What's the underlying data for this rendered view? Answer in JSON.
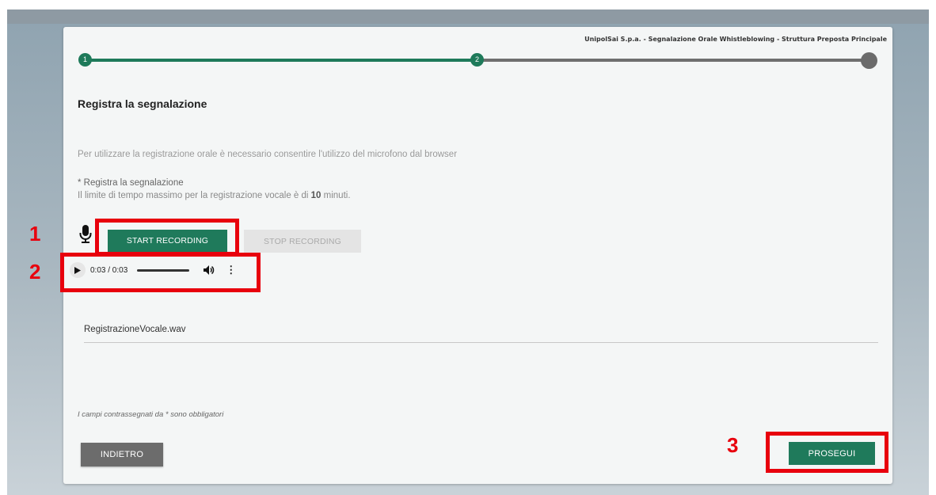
{
  "header": {
    "title": "UnipolSai S.p.a. - Segnalazione Orale Whistleblowing - Struttura Preposta Principale"
  },
  "stepper": {
    "steps": [
      {
        "label": "1",
        "status": "completed"
      },
      {
        "label": "2",
        "status": "active"
      },
      {
        "label": "",
        "status": "pending"
      }
    ],
    "colors": {
      "done": "#1e7a5a",
      "todo": "#6f6f6f"
    }
  },
  "form": {
    "title": "Registra la segnalazione",
    "info": "Per utilizzare la registrazione orale è necessario consentire l'utilizzo del microfono dal browser",
    "required_label": "* Registra la segnalazione",
    "limit_prefix": "Il limite di tempo massimo per la registrazione vocale è di ",
    "limit_value": "10",
    "limit_suffix": " minuti.",
    "mic_icon": "microphone-icon",
    "start_label": "START RECORDING",
    "stop_label": "STOP RECORDING",
    "audio": {
      "time": "0:03 / 0:03",
      "progress": 1.0
    },
    "file_name": "RegistrazioneVocale.wav",
    "required_note": "I campi contrassegnati da * sono obbligatori"
  },
  "footer": {
    "back_label": "INDIETRO",
    "next_label": "PROSEGUI"
  },
  "annotations": [
    "1",
    "2",
    "3"
  ],
  "colors": {
    "accent": "#1f7a5b",
    "highlight": "#e8000d"
  }
}
